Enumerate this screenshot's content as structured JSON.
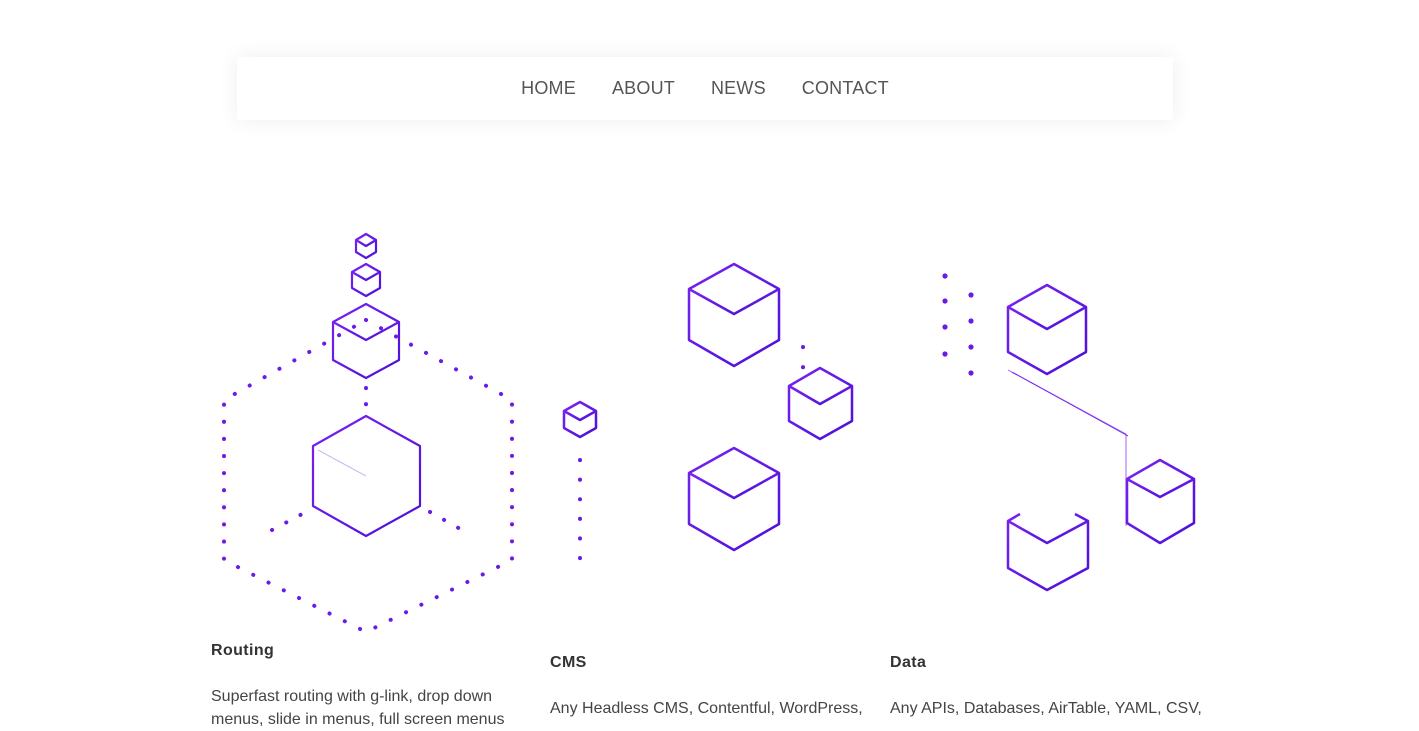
{
  "nav": {
    "items": [
      {
        "label": "HOME"
      },
      {
        "label": "ABOUT"
      },
      {
        "label": "NEWS"
      },
      {
        "label": "CONTACT"
      }
    ]
  },
  "colors": {
    "accent": "#6a1be8",
    "accent_light": "#b17cff"
  },
  "features": [
    {
      "title": "Routing",
      "description": "Superfast routing with g-link, drop down menus, slide in menus, full screen menus"
    },
    {
      "title": "CMS",
      "description": "Any Headless CMS, Contentful, WordPress,"
    },
    {
      "title": "Data",
      "description": "Any APIs, Databases, AirTable, YAML, CSV,"
    }
  ]
}
